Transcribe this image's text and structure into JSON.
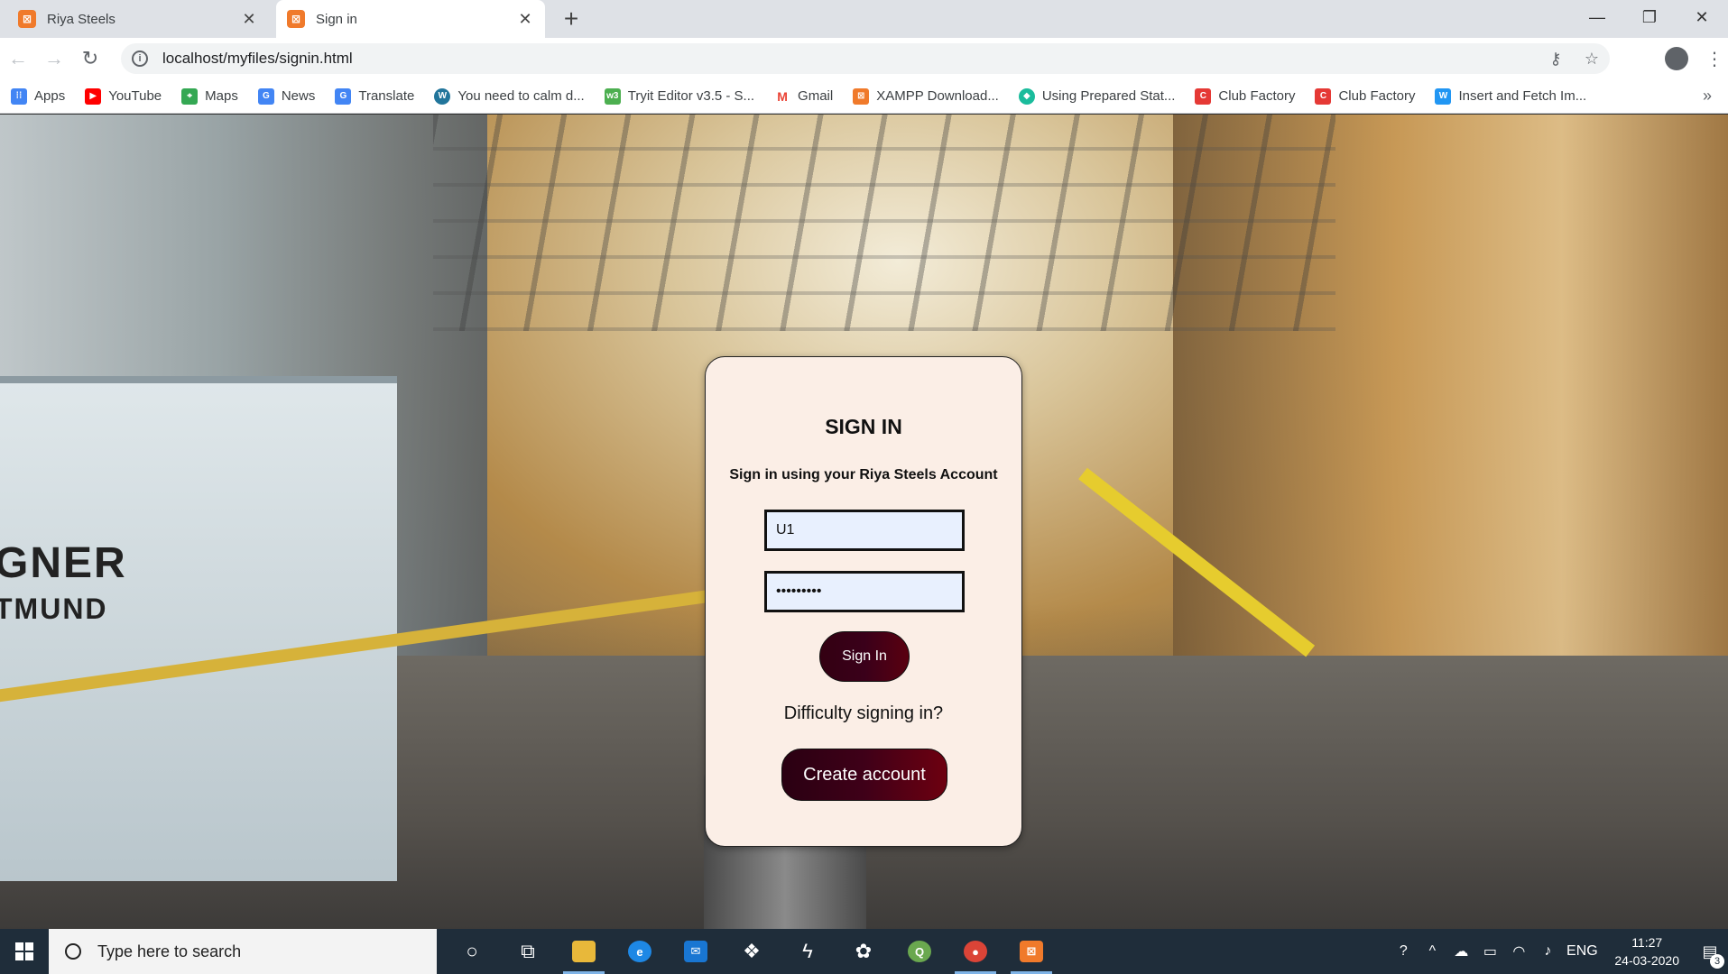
{
  "browser": {
    "tabs": [
      {
        "label": "Riya Steels",
        "active": false
      },
      {
        "label": "Sign in",
        "active": true
      }
    ],
    "new_tab_symbol": "+",
    "window_controls": {
      "minimize": "—",
      "restore": "❐",
      "close": "✕"
    },
    "url": "localhost/myfiles/signin.html",
    "bookmarks": [
      {
        "label": "Apps",
        "icon": "apps-grid-icon",
        "color": "#4285f4"
      },
      {
        "label": "YouTube",
        "icon": "youtube-icon",
        "color": "#ff0000"
      },
      {
        "label": "Maps",
        "icon": "maps-icon",
        "color": "#34a853"
      },
      {
        "label": "News",
        "icon": "news-icon",
        "color": "#4285f4"
      },
      {
        "label": "Translate",
        "icon": "translate-icon",
        "color": "#4285f4"
      },
      {
        "label": "You need to calm d...",
        "icon": "wordpress-icon",
        "color": "#21759b"
      },
      {
        "label": "Tryit Editor v3.5 - S...",
        "icon": "w3schools-icon",
        "color": "#4caf50"
      },
      {
        "label": "Gmail",
        "icon": "gmail-icon",
        "color": "#ea4335"
      },
      {
        "label": "XAMPP Download...",
        "icon": "xampp-icon",
        "color": "#f07a2b"
      },
      {
        "label": "Using Prepared Stat...",
        "icon": "hex-icon",
        "color": "#1abc9c"
      },
      {
        "label": "Club Factory",
        "icon": "clubfactory-icon",
        "color": "#e53935"
      },
      {
        "label": "Club Factory",
        "icon": "clubfactory-icon",
        "color": "#e53935"
      },
      {
        "label": "Insert and Fetch Im...",
        "icon": "w-icon",
        "color": "#2196f3"
      }
    ],
    "bookmarks_more": "»"
  },
  "signin": {
    "title": "SIGN IN",
    "subtitle": "Sign in using your Riya Steels Account",
    "username_value": "U1",
    "password_value": "password1",
    "signin_label": "Sign In",
    "difficulty_text": "Difficulty signing in?",
    "create_label": "Create account"
  },
  "taskbar": {
    "search_placeholder": "Type here to search",
    "language": "ENG",
    "time": "11:27",
    "date": "24-03-2020",
    "notification_count": "3"
  },
  "machine_text": {
    "line1": "GNER",
    "line2": "TMUND"
  },
  "colors": {
    "card_bg": "#fbeee6",
    "button_dark": "#3a001a",
    "button_red": "#6d0010",
    "field_bg": "#e8f0fe",
    "taskbar_bg": "#1f2d3a"
  }
}
